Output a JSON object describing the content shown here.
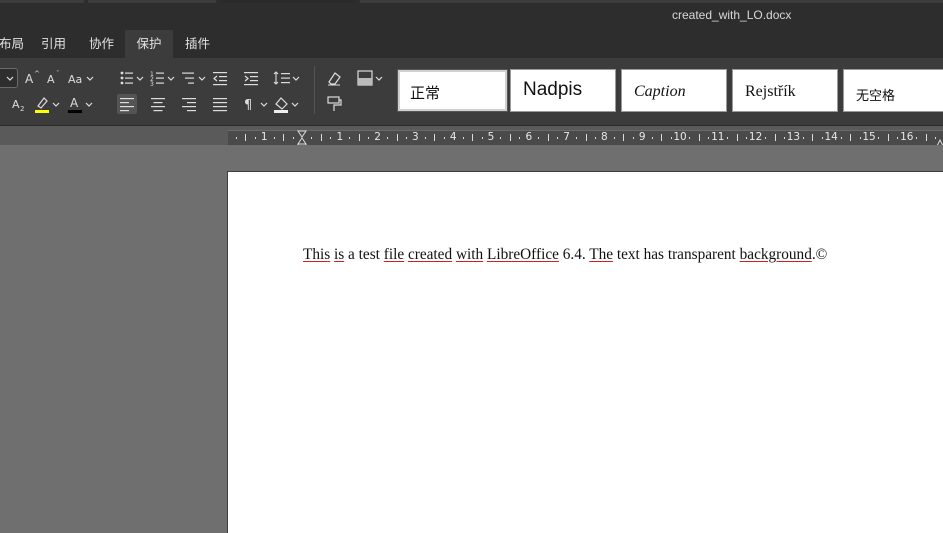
{
  "window": {
    "title": "created_with_LO.docx"
  },
  "menu": {
    "tabs": [
      {
        "label": "布局",
        "visible_text": "布局"
      },
      {
        "label": "引用"
      },
      {
        "label": "协作"
      },
      {
        "label": "保护",
        "active": true
      },
      {
        "label": "插件"
      }
    ]
  },
  "toolbar": {
    "styles": [
      {
        "label": "正常",
        "selected": true
      },
      {
        "label": "Nadpis"
      },
      {
        "label": "Caption"
      },
      {
        "label": "Rejstřík"
      },
      {
        "label": "无空格"
      }
    ],
    "highlight_color": "#ffff00",
    "font_color": "#000000"
  },
  "ruler": {
    "numbers": [
      "1",
      "1",
      "2",
      "3",
      "4",
      "5",
      "6",
      "7",
      "8",
      "9",
      "10",
      "11",
      "12",
      "13",
      "14",
      "15",
      "16"
    ]
  },
  "document": {
    "words": [
      {
        "t": "This",
        "mark": "wavy"
      },
      {
        "t": " "
      },
      {
        "t": "is",
        "mark": "wavy"
      },
      {
        "t": " a test "
      },
      {
        "t": "file",
        "mark": "wavy"
      },
      {
        "t": " "
      },
      {
        "t": "created",
        "mark": "wavy"
      },
      {
        "t": " "
      },
      {
        "t": "with",
        "mark": "wavy"
      },
      {
        "t": " "
      },
      {
        "t": "LibreOffice",
        "mark": "wavy"
      },
      {
        "t": " 6.4. "
      },
      {
        "t": "The",
        "mark": "wavy"
      },
      {
        "t": " text has transparent "
      },
      {
        "t": "background",
        "mark": "wavy"
      },
      {
        "t": ".©"
      }
    ]
  }
}
